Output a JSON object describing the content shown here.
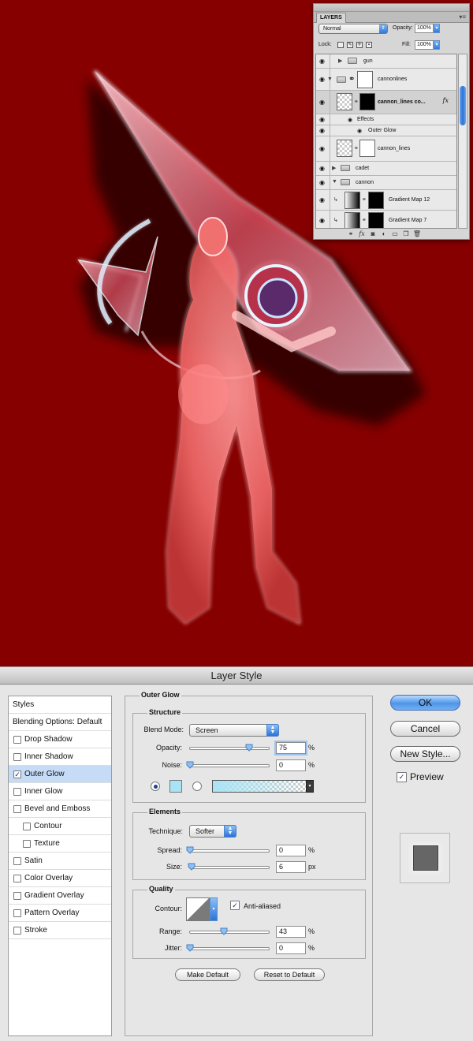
{
  "layers_panel": {
    "tab": "LAYERS",
    "blend_mode": "Normal",
    "opacity_label": "Opacity:",
    "opacity_value": "100%",
    "lock_label": "Lock:",
    "fill_label": "Fill:",
    "fill_value": "100%",
    "layers": [
      {
        "name": "gun",
        "type": "group",
        "expanded": false
      },
      {
        "name": "cannonlines",
        "type": "group",
        "expanded": true
      },
      {
        "name": "cannon_lines co...",
        "type": "layer",
        "selected": true,
        "fx": "fx"
      },
      {
        "name": "Effects",
        "type": "effects"
      },
      {
        "name": "Outer Glow",
        "type": "effect"
      },
      {
        "name": "cannon_lines",
        "type": "layer"
      },
      {
        "name": "cadet",
        "type": "group",
        "expanded": false
      },
      {
        "name": "cannon",
        "type": "group",
        "expanded": true
      },
      {
        "name": "Gradient Map 12",
        "type": "adjustment"
      },
      {
        "name": "Gradient Map 7",
        "type": "adjustment"
      }
    ]
  },
  "dialog": {
    "title": "Layer Style",
    "styles": [
      {
        "label": "Styles",
        "kind": "head"
      },
      {
        "label": "Blending Options: Default",
        "kind": "head"
      },
      {
        "label": "Drop Shadow",
        "checked": false
      },
      {
        "label": "Inner Shadow",
        "checked": false
      },
      {
        "label": "Outer Glow",
        "checked": true,
        "selected": true
      },
      {
        "label": "Inner Glow",
        "checked": false
      },
      {
        "label": "Bevel and Emboss",
        "checked": false
      },
      {
        "label": "Contour",
        "checked": false,
        "sub": true
      },
      {
        "label": "Texture",
        "checked": false,
        "sub": true
      },
      {
        "label": "Satin",
        "checked": false
      },
      {
        "label": "Color Overlay",
        "checked": false
      },
      {
        "label": "Gradient Overlay",
        "checked": false
      },
      {
        "label": "Pattern Overlay",
        "checked": false
      },
      {
        "label": "Stroke",
        "checked": false
      }
    ],
    "panel_title": "Outer Glow",
    "structure": {
      "title": "Structure",
      "blend_mode_label": "Blend Mode:",
      "blend_mode": "Screen",
      "opacity_label": "Opacity:",
      "opacity": "75",
      "opacity_unit": "%",
      "noise_label": "Noise:",
      "noise": "0",
      "noise_unit": "%",
      "glow_color": "#a8e4f5"
    },
    "elements": {
      "title": "Elements",
      "technique_label": "Technique:",
      "technique": "Softer",
      "spread_label": "Spread:",
      "spread": "0",
      "spread_unit": "%",
      "size_label": "Size:",
      "size": "6",
      "size_unit": "px"
    },
    "quality": {
      "title": "Quality",
      "contour_label": "Contour:",
      "anti_aliased_label": "Anti-aliased",
      "anti_aliased": true,
      "range_label": "Range:",
      "range": "43",
      "range_unit": "%",
      "jitter_label": "Jitter:",
      "jitter": "0",
      "jitter_unit": "%"
    },
    "make_default": "Make Default",
    "reset_default": "Reset to Default",
    "ok": "OK",
    "cancel": "Cancel",
    "new_style": "New Style...",
    "preview_label": "Preview",
    "preview_checked": true
  },
  "colors": {
    "canvas_background": "#870000",
    "accent": "#3b86e0"
  }
}
